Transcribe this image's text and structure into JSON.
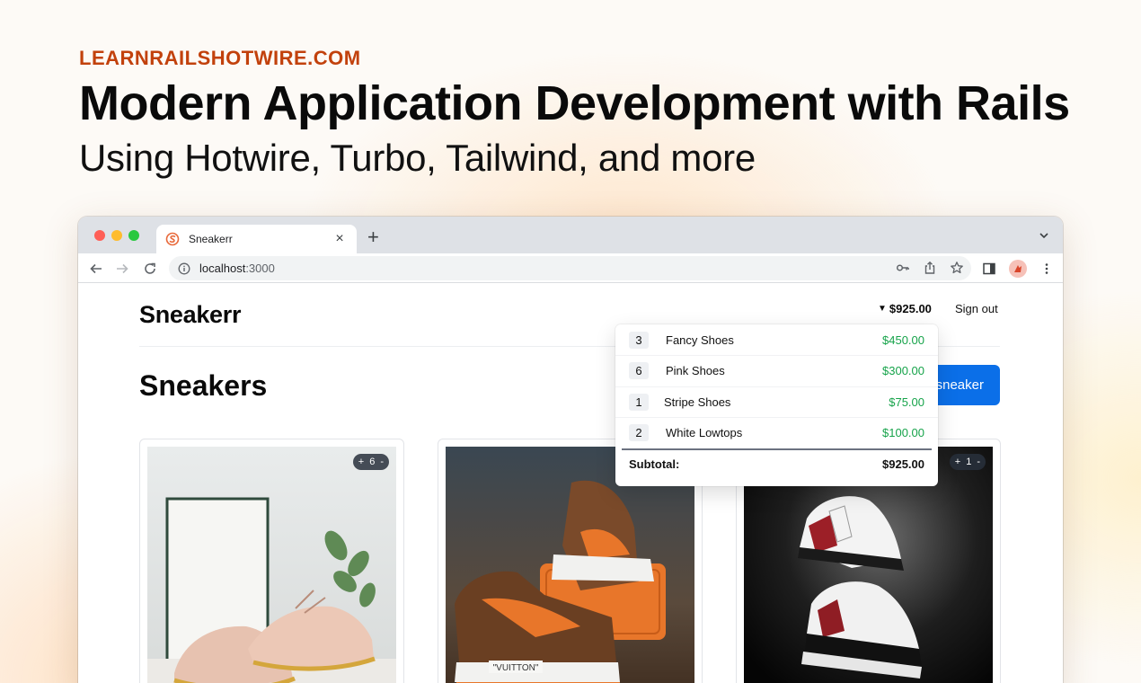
{
  "hero": {
    "kicker": "LEARNRAILSHOTWIRE.COM",
    "title": "Modern Application Development with Rails",
    "subtitle": "Using Hotwire, Turbo, Tailwind, and more"
  },
  "browser": {
    "tab_title": "Sneakerr",
    "url_host": "localhost",
    "url_port": ":3000"
  },
  "app": {
    "logo": "Sneakerr",
    "cart_total": "$925.00",
    "sign_out": "Sign out",
    "page_title": "Sneakers",
    "new_button": "sneaker",
    "cards": [
      {
        "qty": "6",
        "plus": "+",
        "minus": "-"
      },
      {
        "qty": "",
        "plus": "",
        "minus": ""
      },
      {
        "qty": "1",
        "plus": "+",
        "minus": "-"
      }
    ]
  },
  "cart_dropdown": {
    "items": [
      {
        "qty": "3",
        "name": "Fancy Shoes",
        "price": "$450.00"
      },
      {
        "qty": "6",
        "name": "Pink Shoes",
        "price": "$300.00"
      },
      {
        "qty": "1",
        "name": "Stripe Shoes",
        "price": "$75.00"
      },
      {
        "qty": "2",
        "name": "White Lowtops",
        "price": "$100.00"
      }
    ],
    "subtotal_label": "Subtotal:",
    "subtotal_value": "$925.00"
  },
  "colors": {
    "kicker": "#c2410c",
    "primary_button": "#0b6fe8",
    "price_green": "#16a34a"
  }
}
